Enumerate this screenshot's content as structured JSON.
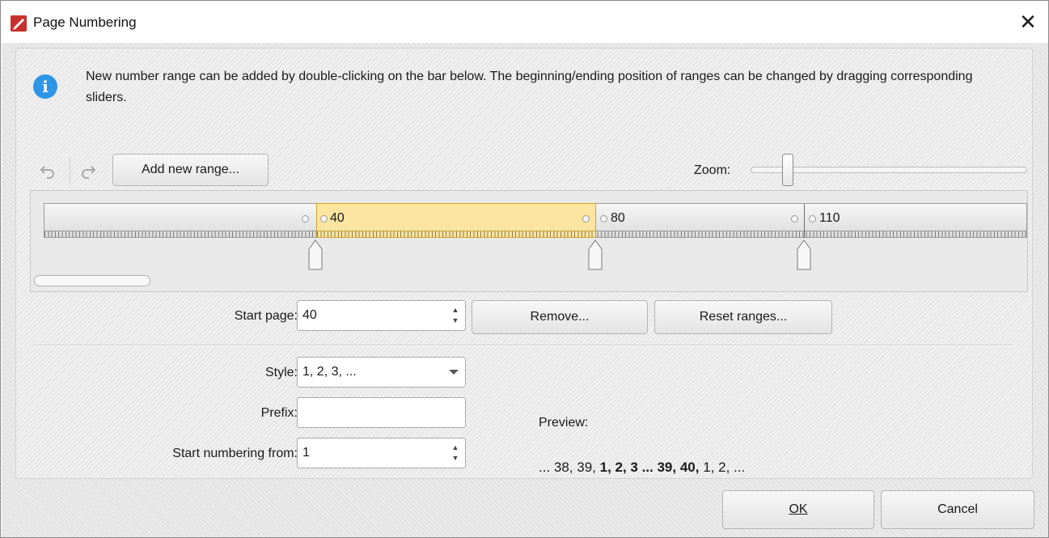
{
  "window": {
    "title": "Page Numbering",
    "close_glyph": "✕"
  },
  "info": {
    "icon": "info-icon",
    "glyph": "i",
    "text": "New number range can be added by double-clicking on the bar below. The beginning/ending position of ranges can be changed by dragging corresponding sliders."
  },
  "toolbar": {
    "undo_icon": "undo-icon",
    "redo_icon": "redo-icon",
    "add_range_label": "Add new range...",
    "zoom_label": "Zoom:",
    "zoom_level_fraction": 0.12
  },
  "ruler": {
    "ranges": [
      {
        "label": "40",
        "selected": true
      },
      {
        "label": "80",
        "selected": false
      },
      {
        "label": "110",
        "selected": false
      }
    ],
    "selected_color": "#fbe5a0"
  },
  "range_controls": {
    "start_page_label": "Start page:",
    "start_page_value": "40",
    "remove_label": "Remove...",
    "reset_label": "Reset ranges..."
  },
  "format": {
    "style_label": "Style:",
    "style_value": "1, 2, 3, ...",
    "prefix_label": "Prefix:",
    "prefix_value": "",
    "start_from_label": "Start numbering from:",
    "start_from_value": "1"
  },
  "preview": {
    "label": "Preview:",
    "part1": "... 38, 39, ",
    "part2": "1, 2, 3 ... 39, 40,",
    "part3": " 1, 2, ..."
  },
  "footer": {
    "ok_label": "OK",
    "cancel_label": "Cancel"
  },
  "colors": {
    "accent_info": "#2e95e6",
    "app_icon": "#c8302e"
  }
}
